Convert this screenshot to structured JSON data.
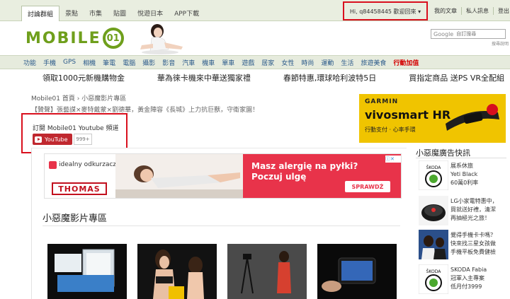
{
  "top_nav": {
    "tabs": [
      {
        "label": "討論群組"
      },
      {
        "label": "景點"
      },
      {
        "label": "市集"
      },
      {
        "label": "貼圖"
      },
      {
        "label": "悅遊日本"
      },
      {
        "label": "APP下載"
      }
    ],
    "greeting": "Hi, q84458445 歡迎回來",
    "links": [
      {
        "label": "我的文章"
      },
      {
        "label": "私人訊息"
      },
      {
        "label": "登出"
      }
    ]
  },
  "header": {
    "logo_text": "MOBILE",
    "logo_num": "01",
    "search_brand": "Google",
    "search_placeholder": "自訂搜尋",
    "search_note": "搜尋說明"
  },
  "categories": [
    "功能",
    "手機",
    "GPS",
    "相機",
    "筆電",
    "電腦",
    "攝影",
    "影音",
    "汽車",
    "機車",
    "單車",
    "遊戲",
    "居家",
    "女性",
    "時尚",
    "運動",
    "生活",
    "旅遊美食",
    "行動加值"
  ],
  "promos": [
    "領取1000元新機購物金",
    "華為徠卡機來中華送獨家禮",
    "春節特惠,環球哈利波特5日",
    "買指定商品 送PS VR全配組"
  ],
  "breadcrumb": {
    "home": "Mobile01 首頁",
    "sep": "›",
    "current": "小惡魔影片專區"
  },
  "notice": "【贊聲】張藝謀×麥特戴蒙×劉德華，黃金陣容《長城》上力抗巨獸，守衛家園！",
  "youtube": {
    "title": "訂閱 Mobile01 Youtube 頻道",
    "button_label": "YouTube",
    "count": "999+"
  },
  "garmin_ad": {
    "brand": "GARMIN",
    "product": "vivosmart HR",
    "tagline": "行動支付 · 心率手環"
  },
  "banner_ad": {
    "brand": "idealny odkurzacz.pl",
    "thomas": "THOMAS",
    "headline": "Masz alergię na pyłki?",
    "subline": "Poczuj ulgę",
    "button": "SPRAWDŹ"
  },
  "section_title": "小惡魔影片專區",
  "sidebar": {
    "title": "小惡魔廣告快訊",
    "items": [
      {
        "lines": [
          "展系休旅",
          "Yeti Black",
          "60萬0利率"
        ]
      },
      {
        "lines": [
          "LG小家電特惠中，",
          "買就送好禮，清潔",
          "再抽極光之旅！"
        ]
      },
      {
        "lines": [
          "覺得手機卡卡嗎？",
          "快來找三星女孩做",
          "手機平板免費健檢"
        ]
      },
      {
        "lines": [
          "SKODA Fabia",
          "冠軍入主專案",
          "低月付3999"
        ]
      }
    ]
  },
  "colors": {
    "brand_green": "#6f9f1c",
    "highlight_red": "#d9101e",
    "youtube_red": "#c0282f",
    "garmin_yellow": "#f0c400"
  }
}
